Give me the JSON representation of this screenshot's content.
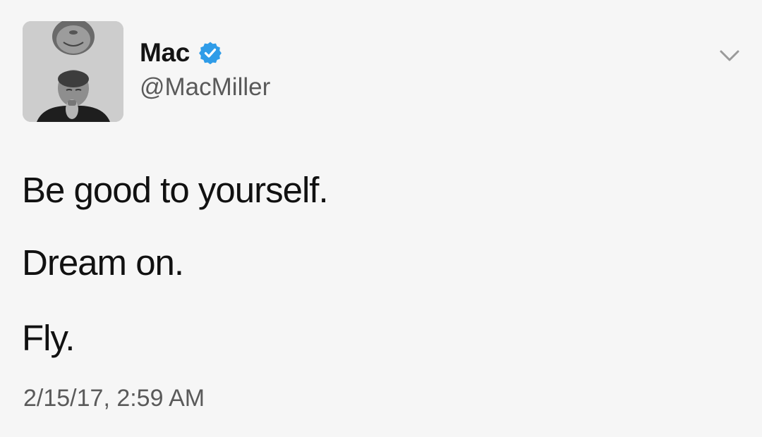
{
  "user": {
    "display_name": "Mac",
    "handle": "@MacMiller",
    "verified": true
  },
  "icons": {
    "verified": "verified-badge-icon",
    "menu": "chevron-down-icon"
  },
  "tweet": {
    "lines": [
      "Be good to yourself.",
      "Dream on.",
      "Fly."
    ],
    "timestamp": "2/15/17, 2:59 AM"
  },
  "colors": {
    "verified_badge": "#2f9ce8",
    "handle_text": "#5a5a5a",
    "background": "#f6f6f6"
  }
}
